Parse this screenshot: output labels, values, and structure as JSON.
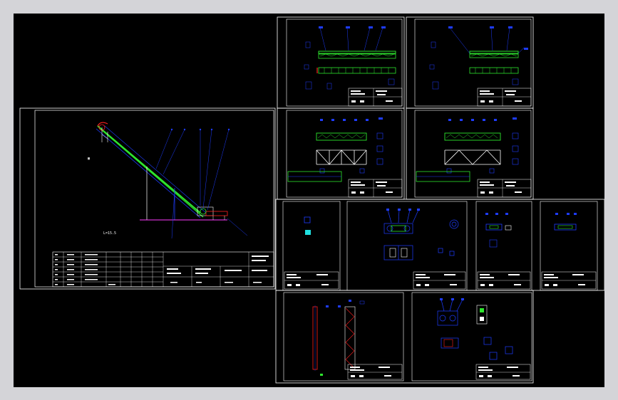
{
  "canvas": {
    "background": "#000000",
    "frame_color": "#ffffff",
    "bg_outer": "#d4d4d8"
  },
  "colors": {
    "blue": "#1e3cff",
    "green": "#2ee62e",
    "red": "#ff2020",
    "magenta": "#ff3cff",
    "white": "#ffffff",
    "yellow": "#ffff40",
    "cyan": "#20e0e0"
  },
  "main_drawing": {
    "length_label": "L=15.5"
  },
  "sheets": [
    {
      "id": "s1",
      "kind": "conveyor-plan"
    },
    {
      "id": "s2",
      "kind": "conveyor-plan"
    },
    {
      "id": "s3",
      "kind": "truss-elevation"
    },
    {
      "id": "s4",
      "kind": "truss-elevation"
    },
    {
      "id": "s5",
      "kind": "small-part"
    },
    {
      "id": "s6",
      "kind": "drive-assembly"
    },
    {
      "id": "s7",
      "kind": "bracket"
    },
    {
      "id": "s8",
      "kind": "bracket"
    },
    {
      "id": "s9",
      "kind": "vertical-leg"
    },
    {
      "id": "s10",
      "kind": "motor-unit"
    }
  ]
}
